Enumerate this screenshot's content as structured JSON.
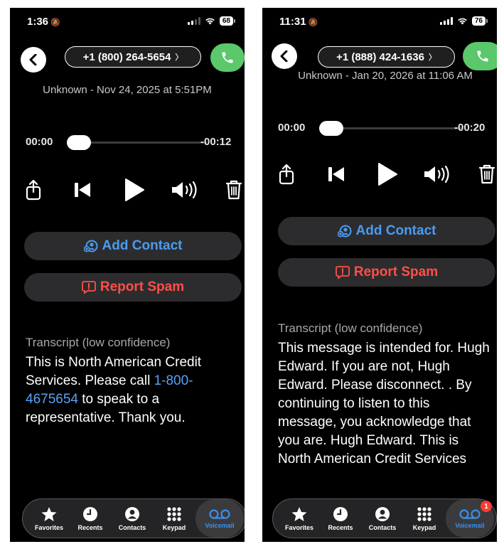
{
  "left": {
    "status": {
      "time": "1:36",
      "battery": "68"
    },
    "header": {
      "phone_number": "+1 (800) 264-5654"
    },
    "caller_info": "Unknown - Nov 24, 2025 at 5:51PM",
    "player": {
      "elapsed": "00:00",
      "remaining": "-00:12",
      "progress": 0.0
    },
    "actions": {
      "add_contact": "Add Contact",
      "report_spam": "Report Spam"
    },
    "transcript": {
      "label": "Transcript (low confidence)",
      "text_before": "This is North American Credit Services. Please call ",
      "link": "1-800-4675654",
      "text_after": " to speak to a representative. Thank you."
    },
    "tabbar": {
      "favorites": "Favorites",
      "recents": "Recents",
      "contacts": "Contacts",
      "keypad": "Keypad",
      "voicemail": "Voicemail"
    }
  },
  "right": {
    "status": {
      "time": "11:31",
      "battery": "76"
    },
    "header": {
      "phone_number": "+1 (888) 424-1636"
    },
    "caller_info": "Unknown - Jan 20, 2026 at 11:06 AM",
    "player": {
      "elapsed": "00:00",
      "remaining": "-00:20",
      "progress": 0.0
    },
    "actions": {
      "add_contact": "Add Contact",
      "report_spam": "Report Spam"
    },
    "transcript": {
      "label": "Transcript (low confidence)",
      "text": "This message is intended for. Hugh Edward.  If you are not, Hugh Edward.  Please disconnect. .  By continuing to listen to this message, you acknowledge that you are. Hugh Edward.  This is North American Credit Services"
    },
    "tabbar": {
      "favorites": "Favorites",
      "recents": "Recents",
      "contacts": "Contacts",
      "keypad": "Keypad",
      "voicemail": "Voicemail",
      "voicemail_badge": "1"
    }
  },
  "colors": {
    "accent": "#3a8ff0",
    "call_green": "#5ac86b",
    "spam_red": "#ff4f48",
    "contact_blue": "#4a9cf1"
  },
  "icons": [
    "bell-slash-icon",
    "signal-icon",
    "wifi-icon",
    "battery-icon",
    "back-chevron-icon",
    "phone-icon",
    "share-icon",
    "skip-back-icon",
    "play-icon",
    "speaker-icon",
    "trash-icon",
    "add-contact-icon",
    "report-spam-icon",
    "star-icon",
    "clock-icon",
    "person-icon",
    "keypad-icon",
    "voicemail-icon"
  ]
}
